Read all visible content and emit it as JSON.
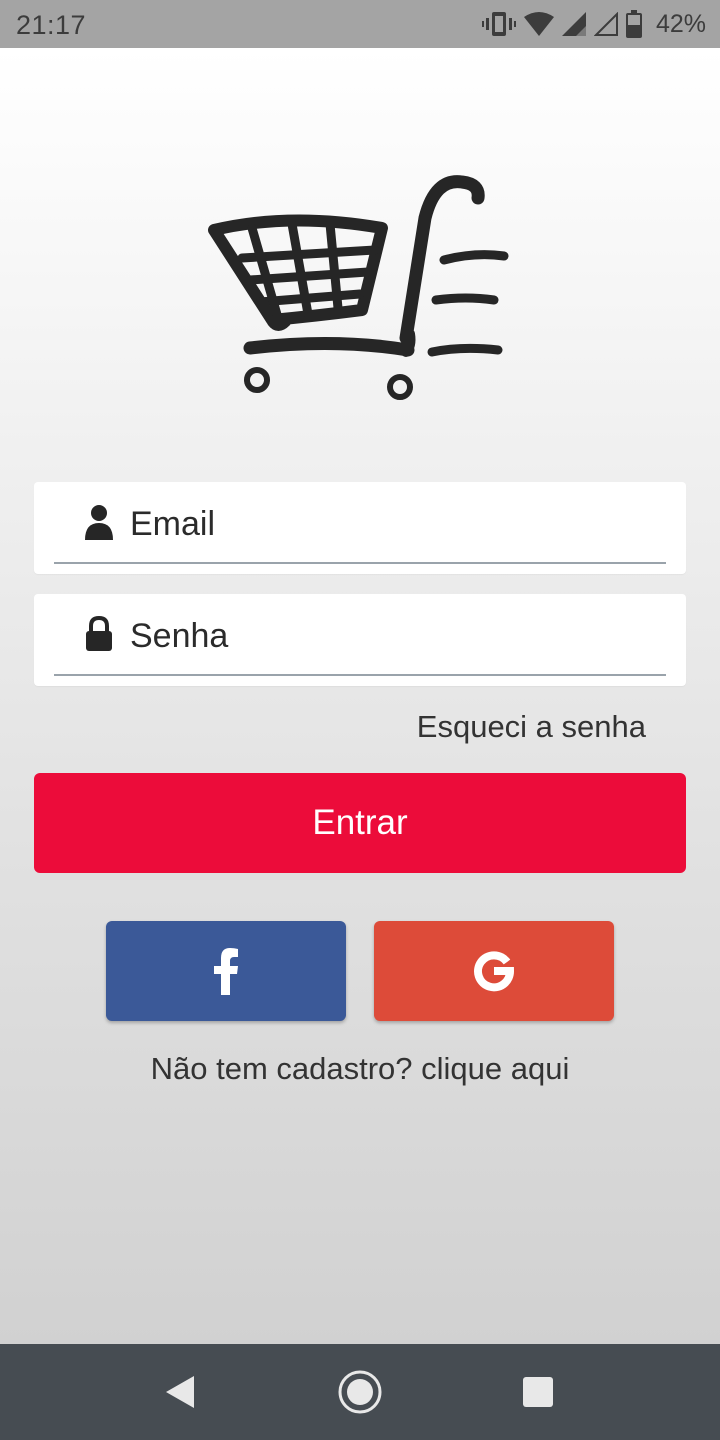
{
  "status_bar": {
    "time": "21:17",
    "battery_percent": "42%",
    "icons": [
      "vibrate-icon",
      "wifi-icon",
      "signal-icon",
      "signal-empty-icon",
      "battery-icon"
    ]
  },
  "logo": {
    "icon": "shopping-cart-icon"
  },
  "form": {
    "email_placeholder": "Email",
    "password_placeholder": "Senha",
    "email_icon": "user-icon",
    "password_icon": "lock-icon",
    "forgot_password": "Esqueci a senha",
    "submit_label": "Entrar"
  },
  "social": {
    "facebook_icon": "facebook-icon",
    "google_icon": "google-icon"
  },
  "signup_text": "Não tem cadastro? clique aqui",
  "nav": {
    "back_icon": "back-icon",
    "home_icon": "home-icon",
    "recents_icon": "recents-icon"
  },
  "colors": {
    "primary": "#EC0C3A",
    "facebook": "#3B5998",
    "google": "#DD4B39",
    "status_bar": "#A4A4A4",
    "nav_bar": "#464C52"
  }
}
